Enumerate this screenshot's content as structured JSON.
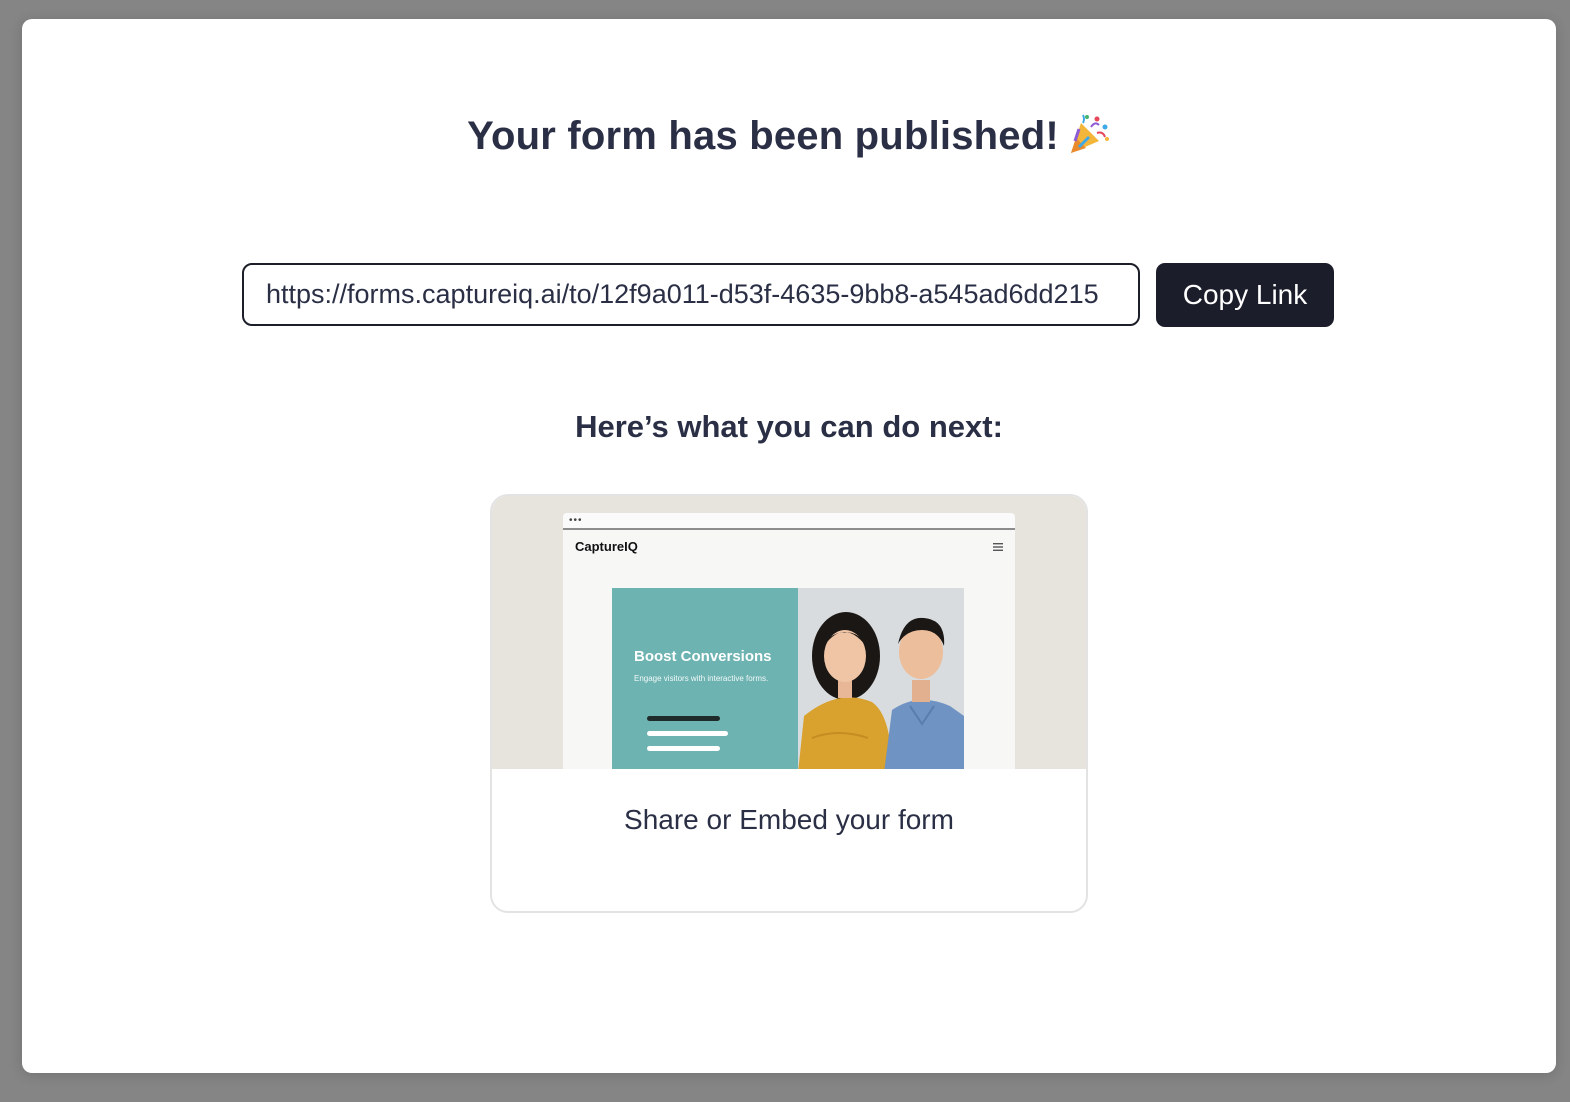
{
  "modal": {
    "title": "Your form has been published!",
    "title_icon": "party-popper-icon"
  },
  "share": {
    "link_value": "https://forms.captureiq.ai/to/12f9a011-d53f-4635-9bb8-a545ad6dd215",
    "copy_label": "Copy Link"
  },
  "next": {
    "heading": "Here’s what you can do next:"
  },
  "cards": [
    {
      "label": "Share or Embed your form",
      "preview": {
        "site_name": "CaptureIQ",
        "hero_title": "Boost Conversions",
        "hero_subtitle": "Engage visitors with interactive forms."
      }
    }
  ],
  "colors": {
    "backdrop": "#858585",
    "primary_button": "#1c1d2a",
    "text": "#2a2f45",
    "hero_teal": "#6db3b1"
  }
}
